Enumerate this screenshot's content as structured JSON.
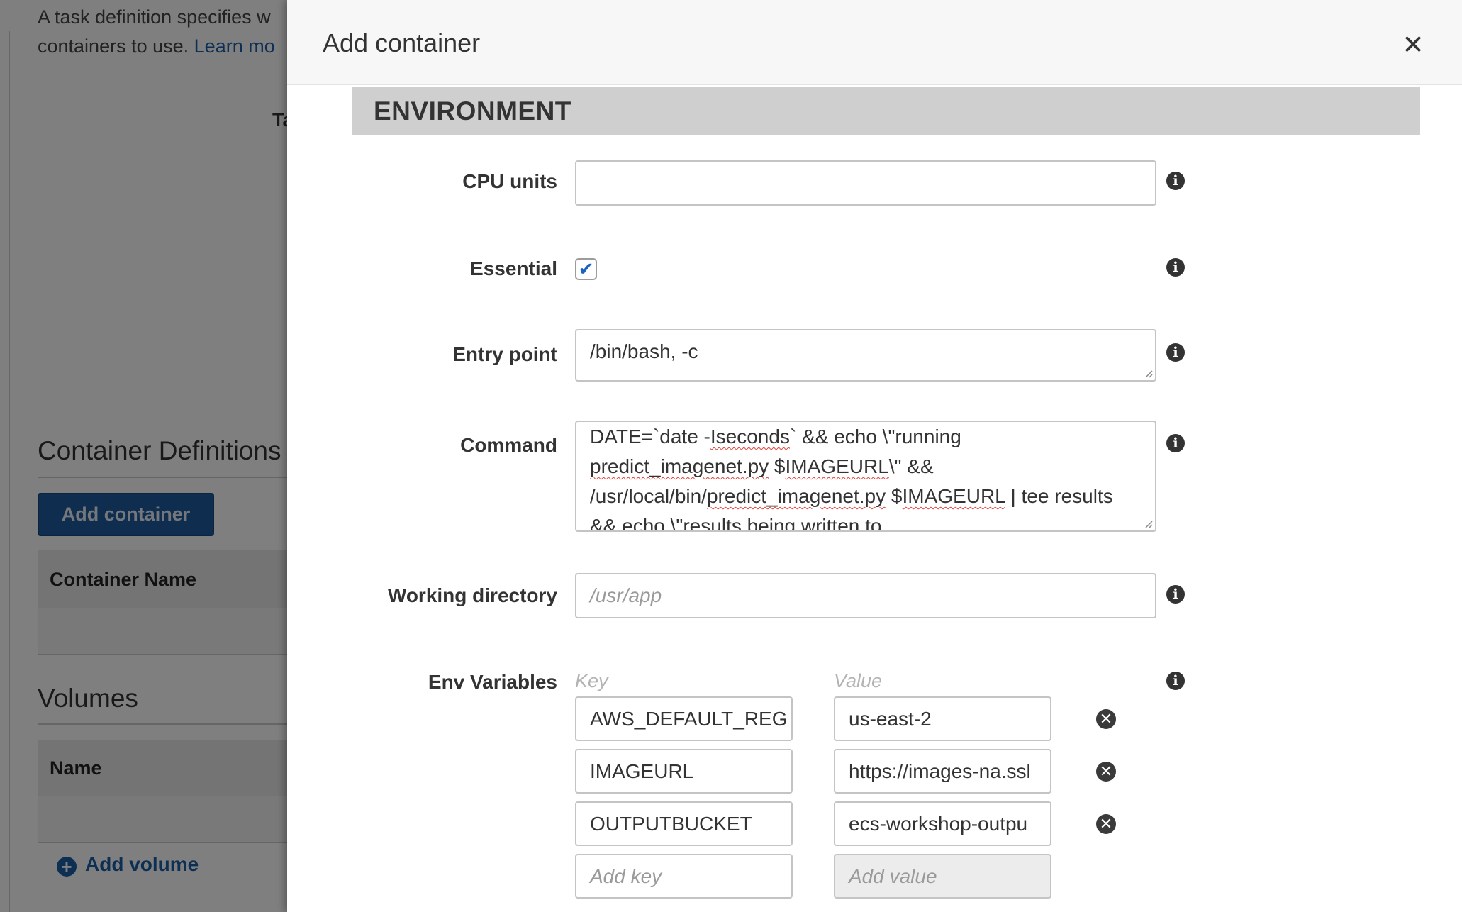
{
  "background": {
    "description_line1": "A task definition specifies w",
    "description_line2": "containers to use.",
    "learn_more": "Learn mo",
    "partial_label": "Ta",
    "container_definitions_heading": "Container Definitions",
    "add_container_button": "Add container",
    "container_name_header": "Container Name",
    "volumes_heading": "Volumes",
    "name_header": "Name",
    "add_volume_link": "Add volume"
  },
  "modal": {
    "title": "Add container",
    "close_icon": "close-icon",
    "section_title": "ENVIRONMENT",
    "cpu_units": {
      "label": "CPU units",
      "value": ""
    },
    "essential": {
      "label": "Essential",
      "checked": true
    },
    "entry_point": {
      "label": "Entry point",
      "value": "/bin/bash, -c"
    },
    "command": {
      "label": "Command",
      "lines": [
        "DATE=`date -Iseconds` && echo \\\"running",
        "predict_imagenet.py $IMAGEURL\\\" &&",
        "/usr/local/bin/predict_imagenet.py $IMAGEURL | tee results",
        "&& echo \\\"results being written to"
      ]
    },
    "working_directory": {
      "label": "Working directory",
      "placeholder": "/usr/app"
    },
    "env_variables": {
      "label": "Env Variables",
      "key_header": "Key",
      "value_header": "Value",
      "rows": [
        {
          "key": "AWS_DEFAULT_REG",
          "value": "us-east-2"
        },
        {
          "key": "IMAGEURL",
          "value": "https://images-na.ssl"
        },
        {
          "key": "OUTPUTBUCKET",
          "value": "ecs-workshop-outpu"
        }
      ],
      "add_key_placeholder": "Add key",
      "add_value_placeholder": "Add value"
    }
  },
  "colors": {
    "primary_button": "#1f5d9e",
    "link": "#1a5ea8",
    "section_bar": "#cfcfcf",
    "checkbox_check": "#1a63c4",
    "spellcheck_underline": "#e0413a"
  }
}
